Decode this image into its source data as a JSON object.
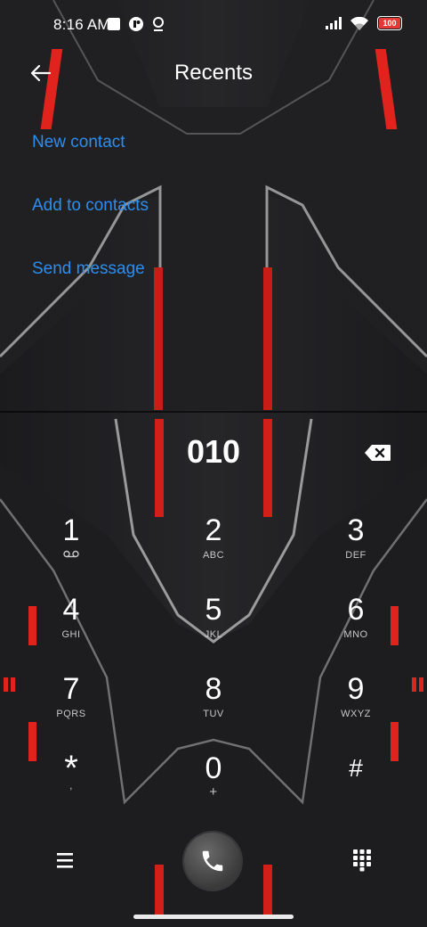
{
  "status_bar": {
    "time": "8:16 AM",
    "battery": "100",
    "icons": [
      "square-notification-icon",
      "app-notification-icon",
      "location-icon",
      "signal-icon",
      "wifi-icon",
      "battery-icon"
    ]
  },
  "header": {
    "title": "Recents",
    "back_icon": "back-arrow-icon"
  },
  "actions": [
    {
      "label": "New contact"
    },
    {
      "label": "Add to contacts"
    },
    {
      "label": "Send message"
    }
  ],
  "dialer": {
    "number": "010",
    "keys": [
      {
        "digit": "1",
        "letters": "ᴏᴏ"
      },
      {
        "digit": "2",
        "letters": "ABC"
      },
      {
        "digit": "3",
        "letters": "DEF"
      },
      {
        "digit": "4",
        "letters": "GHI"
      },
      {
        "digit": "5",
        "letters": "JKL"
      },
      {
        "digit": "6",
        "letters": "MNO"
      },
      {
        "digit": "7",
        "letters": "PQRS"
      },
      {
        "digit": "8",
        "letters": "TUV"
      },
      {
        "digit": "9",
        "letters": "WXYZ"
      },
      {
        "digit": "*",
        "letters": ","
      },
      {
        "digit": "0",
        "letters": "+"
      },
      {
        "digit": "#",
        "letters": ""
      }
    ]
  },
  "colors": {
    "action_link": "#2b8ef0",
    "accent_red": "#e0231c",
    "background": "#141416"
  }
}
